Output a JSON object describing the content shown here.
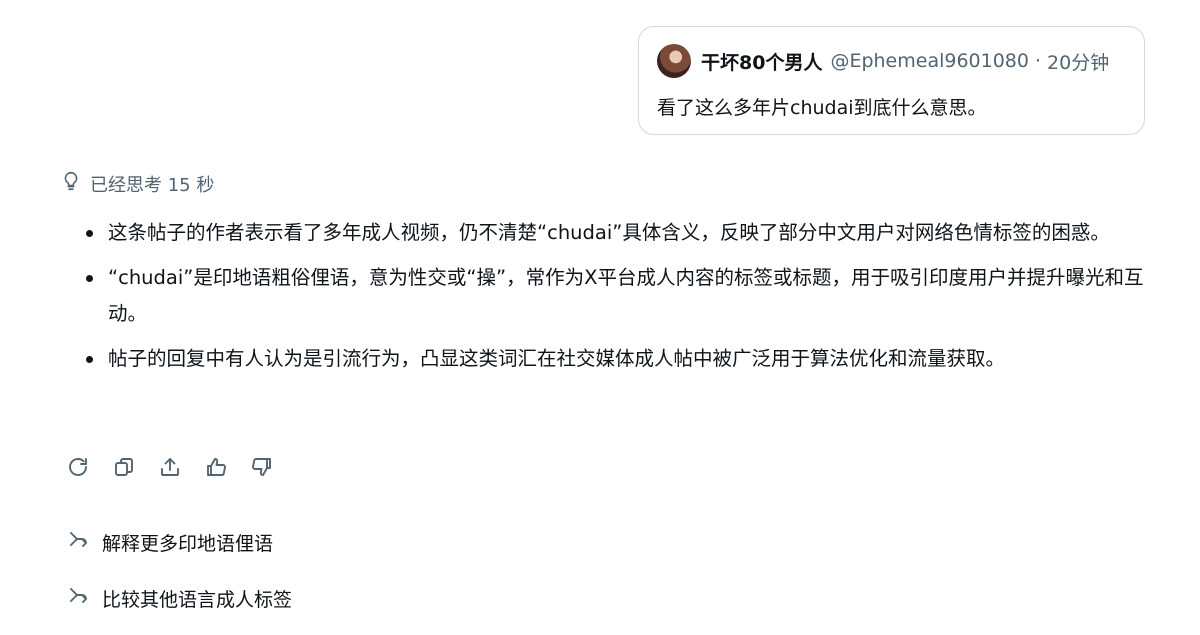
{
  "post": {
    "author": "干坏80个男人",
    "handle": "@Ephemeal9601080",
    "separator": "·",
    "time": "20分钟",
    "text": "看了这么多年片chudai到底什么意思。"
  },
  "thinking": {
    "label": "已经思考 15 秒",
    "icon": "lightbulb-icon"
  },
  "answer": {
    "bullets": [
      "这条帖子的作者表示看了多年成人视频，仍不清楚“chudai”具体含义，反映了部分中文用户对网络色情标签的困惑。",
      "“chudai”是印地语粗俗俚语，意为性交或“操”，常作为X平台成人内容的标签或标题，用于吸引印度用户并提升曝光和互动。",
      "帖子的回复中有人认为是引流行为，凸显这类词汇在社交媒体成人帖中被广泛用于算法优化和流量获取。"
    ]
  },
  "actions": [
    "regenerate-icon",
    "copy-icon",
    "share-icon",
    "thumbs-up-icon",
    "thumbs-down-icon"
  ],
  "suggestions": [
    "解释更多印地语俚语",
    "比较其他语言成人标签"
  ]
}
